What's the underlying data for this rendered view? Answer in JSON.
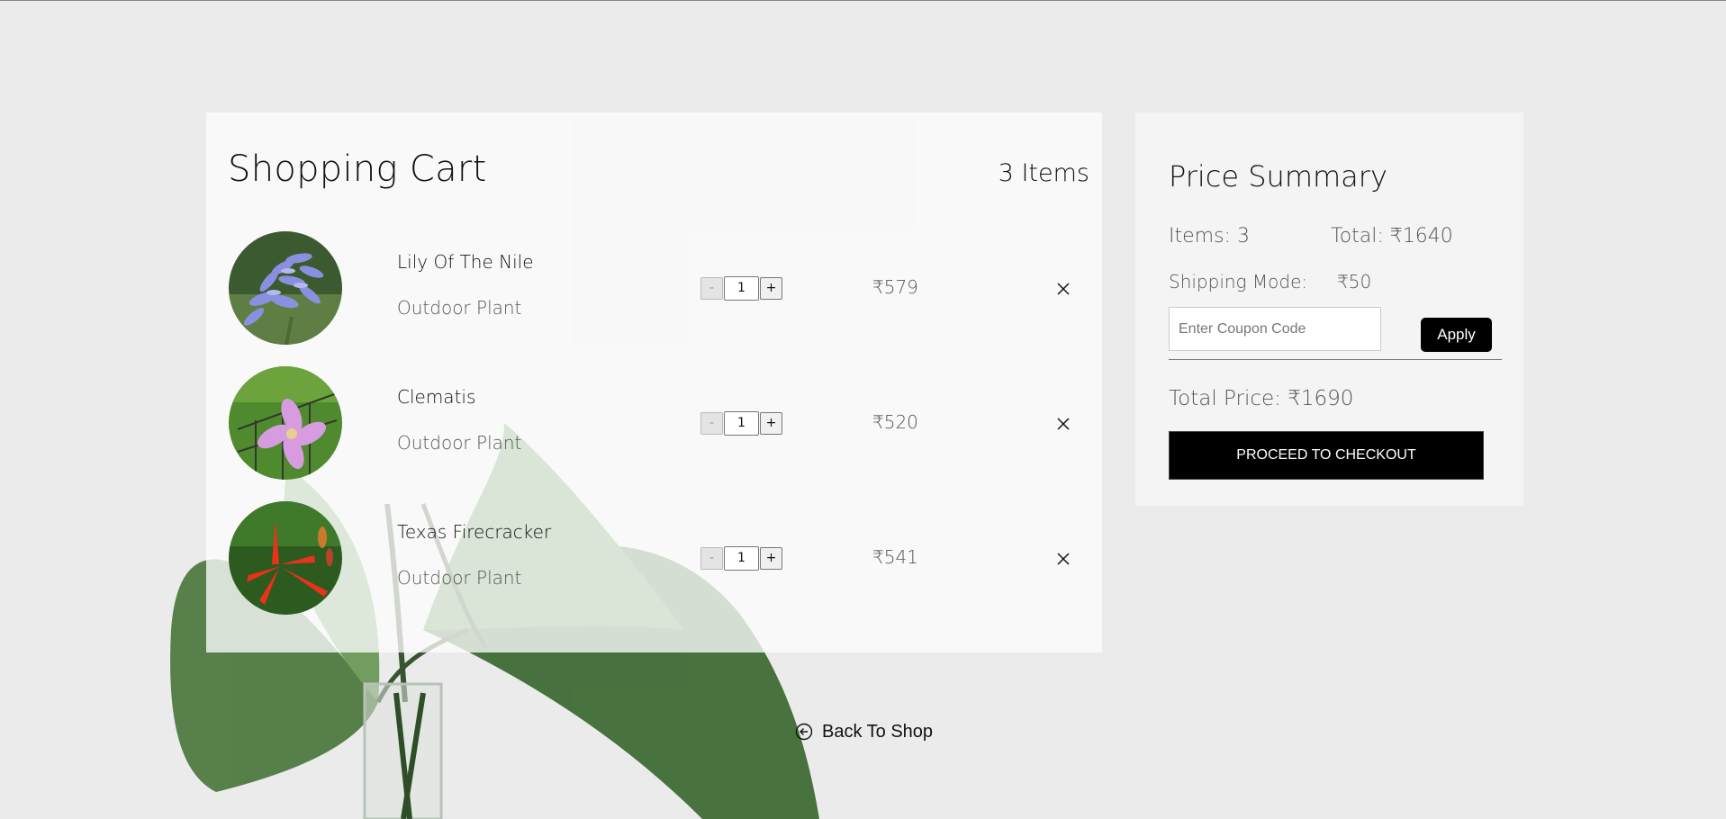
{
  "currency_symbol": "₹",
  "cart": {
    "title": "Shopping Cart",
    "count_label": "3 Items",
    "items": [
      {
        "name": "Lily Of The Nile",
        "type": "Outdoor Plant",
        "quantity": "1",
        "price": "₹579",
        "image": "purple-agapanthus-flower"
      },
      {
        "name": "Clematis",
        "type": "Outdoor Plant",
        "quantity": "1",
        "price": "₹520",
        "image": "pink-clematis-flower"
      },
      {
        "name": "Texas Firecracker",
        "type": "Outdoor Plant",
        "quantity": "1",
        "price": "₹541",
        "image": "red-firecracker-flower"
      }
    ],
    "minus_label": "-",
    "plus_label": "+"
  },
  "summary": {
    "title": "Price Summary",
    "items_label": "Items: 3",
    "total_label": "Total: ₹1640",
    "shipping_label": "Shipping Mode:",
    "shipping_value": "₹50",
    "coupon_placeholder": "Enter Coupon Code",
    "apply_label": "Apply",
    "grand_total_label": "Total Price: ₹1690",
    "checkout_label": "PROCEED TO CHECKOUT"
  },
  "back_link": {
    "label": "Back To Shop"
  },
  "colors": {
    "background": "#ebebeb",
    "button": "#000000",
    "panel": "#fcfcfc"
  }
}
